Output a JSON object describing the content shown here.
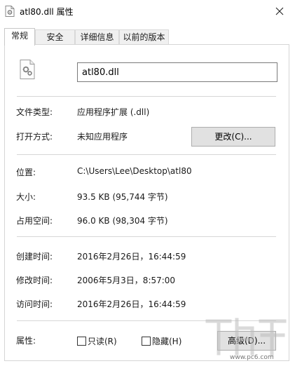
{
  "window": {
    "title": "atl80.dll 属性"
  },
  "tabs": [
    {
      "label": "常规",
      "active": true
    },
    {
      "label": "安全",
      "active": false
    },
    {
      "label": "详细信息",
      "active": false
    },
    {
      "label": "以前的版本",
      "active": false
    }
  ],
  "general": {
    "file_name": "atl80.dll",
    "file_type_label": "文件类型:",
    "file_type_value": "应用程序扩展 (.dll)",
    "opens_with_label": "打开方式:",
    "opens_with_value": "未知应用程序",
    "change_button": "更改(C)...",
    "location_label": "位置:",
    "location_value": "C:\\Users\\Lee\\Desktop\\atl80",
    "size_label": "大小:",
    "size_value": "93.5 KB (95,744 字节)",
    "size_on_disk_label": "占用空间:",
    "size_on_disk_value": "96.0 KB (98,304 字节)",
    "created_label": "创建时间:",
    "created_value": "2016年2月26日，16:44:59",
    "modified_label": "修改时间:",
    "modified_value": "2006年5月3日，8:57:00",
    "accessed_label": "访问时间:",
    "accessed_value": "2016年2月26日，16:44:59",
    "attributes_label": "属性:",
    "readonly_label": "只读(R)",
    "readonly_checked": false,
    "hidden_label": "隐藏(H)",
    "hidden_checked": false,
    "advanced_button": "高级(D)..."
  },
  "watermark": {
    "text": "www.pc6.com"
  },
  "icons": {
    "title": "file-gear-icon",
    "close": "close-icon",
    "file": "dll-file-icon",
    "watermark": "watermark-logo"
  }
}
